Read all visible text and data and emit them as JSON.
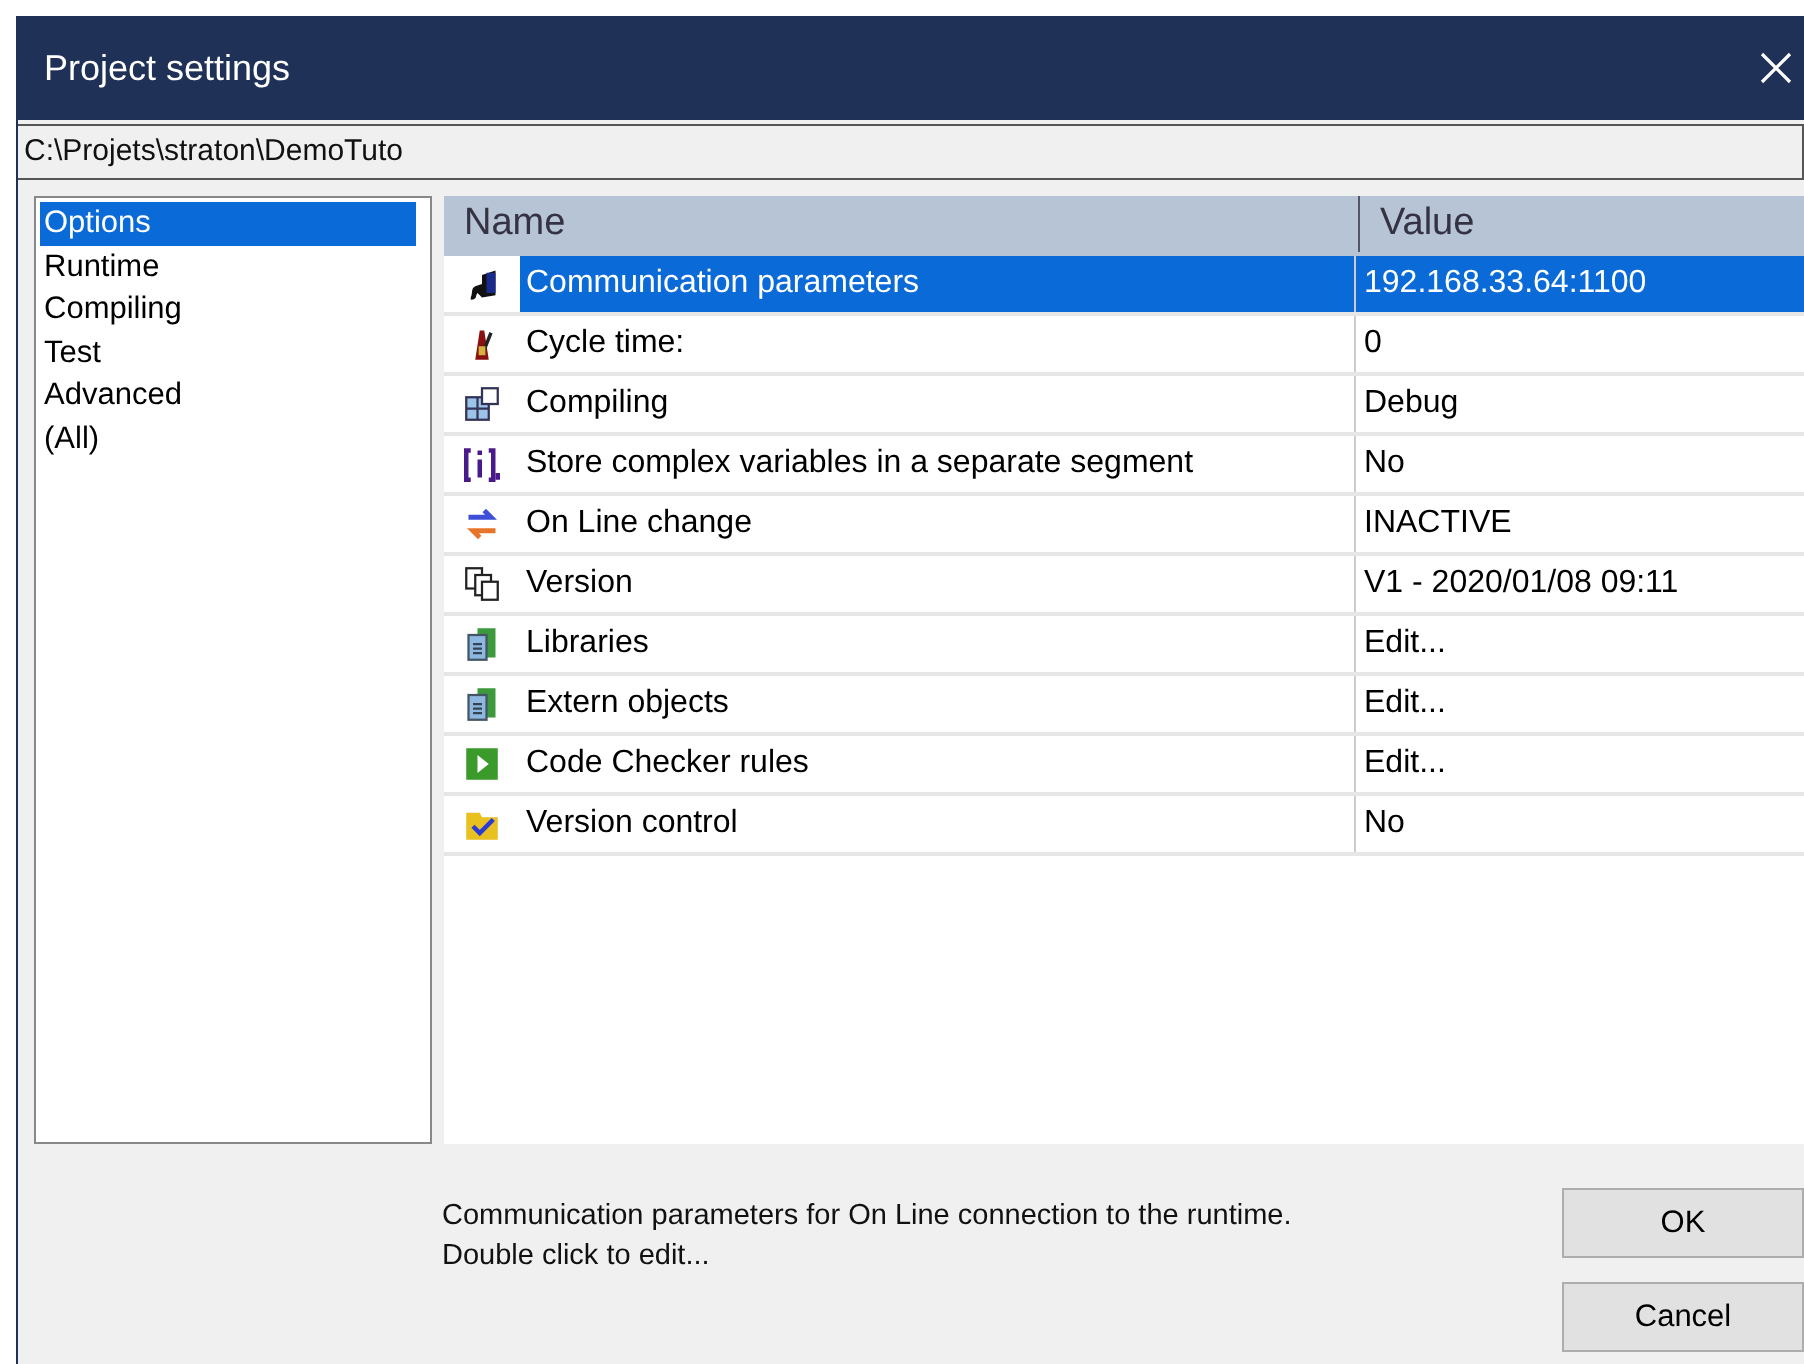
{
  "window": {
    "title": "Project settings",
    "path": "C:\\Projets\\straton\\DemoTuto"
  },
  "categories": [
    {
      "label": "Options",
      "selected": true
    },
    {
      "label": "Runtime",
      "selected": false
    },
    {
      "label": "Compiling",
      "selected": false
    },
    {
      "label": "Test",
      "selected": false
    },
    {
      "label": "Advanced",
      "selected": false
    },
    {
      "label": "(All)",
      "selected": false
    }
  ],
  "table": {
    "columns": [
      "Name",
      "Value"
    ],
    "rows": [
      {
        "name": "Communication parameters",
        "value": "192.168.33.64:1100",
        "selected": true
      },
      {
        "name": "Cycle time:",
        "value": "0",
        "selected": false
      },
      {
        "name": "Compiling",
        "value": "Debug",
        "selected": false
      },
      {
        "name": "Store complex variables in a separate segment",
        "value": "No",
        "selected": false
      },
      {
        "name": "On Line change",
        "value": "INACTIVE",
        "selected": false
      },
      {
        "name": "Version",
        "value": "V1 - 2020/01/08 09:11",
        "selected": false
      },
      {
        "name": "Libraries",
        "value": "Edit...",
        "selected": false
      },
      {
        "name": "Extern objects",
        "value": "Edit...",
        "selected": false
      },
      {
        "name": "Code Checker rules",
        "value": "Edit...",
        "selected": false
      },
      {
        "name": "Version control",
        "value": "No",
        "selected": false
      }
    ]
  },
  "description": [
    "Communication parameters for On Line connection to the runtime.",
    "Double click to edit..."
  ],
  "buttons": [
    "OK",
    "Cancel"
  ]
}
